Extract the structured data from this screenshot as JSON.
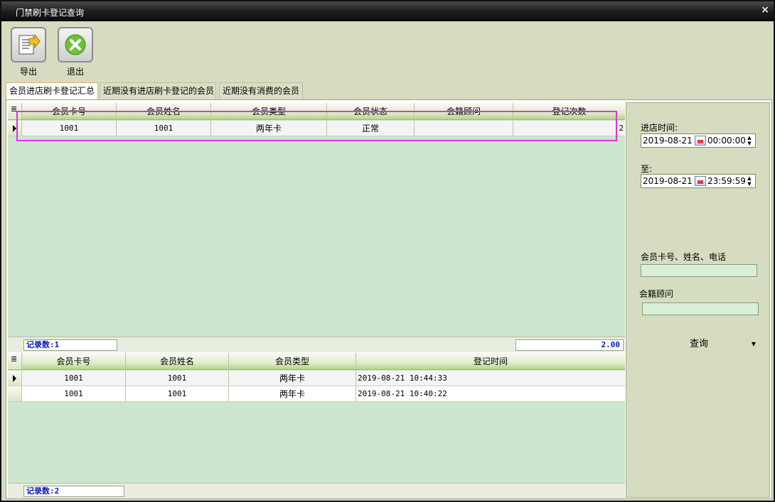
{
  "window": {
    "title": "门禁刷卡登记查询",
    "close": "×"
  },
  "toolbar": [
    {
      "label": "导出",
      "icon": "export-icon"
    },
    {
      "label": "退出",
      "icon": "exit-icon"
    }
  ],
  "tabs": [
    "会员进店刷卡登记汇总",
    "近期没有进店刷卡登记的会员",
    "近期没有消费的会员"
  ],
  "summary_grid": {
    "columns": [
      "会员卡号",
      "会员姓名",
      "会员类型",
      "会员状态",
      "会籍顾问",
      "登记次数"
    ],
    "rows": [
      [
        "1001",
        "1001",
        "两年卡",
        "正常",
        "",
        "2"
      ]
    ],
    "record_count": "记录数:1",
    "total": "2.00"
  },
  "detail_grid": {
    "columns": [
      "会员卡号",
      "会员姓名",
      "会员类型",
      "登记时间"
    ],
    "rows": [
      [
        "1001",
        "1001",
        "两年卡",
        "2019-08-21 10:44:33"
      ],
      [
        "1001",
        "1001",
        "两年卡",
        "2019-08-21 10:40:22"
      ]
    ],
    "record_count": "记录数:2"
  },
  "filters": {
    "start_label": "进店时间:",
    "start_date": "2019-08-21",
    "start_time": "00:00:00",
    "end_label": "至:",
    "end_date": "2019-08-21",
    "end_time": "23:59:59",
    "member_label": "会员卡号、姓名、电话",
    "member_value": "",
    "advisor_label": "会籍顾问",
    "advisor_value": "",
    "query_label": "查询"
  },
  "colors": {
    "highlight": "#e030e0",
    "grid_bg": "#cce6cf",
    "count_text": "#0a18c0"
  }
}
